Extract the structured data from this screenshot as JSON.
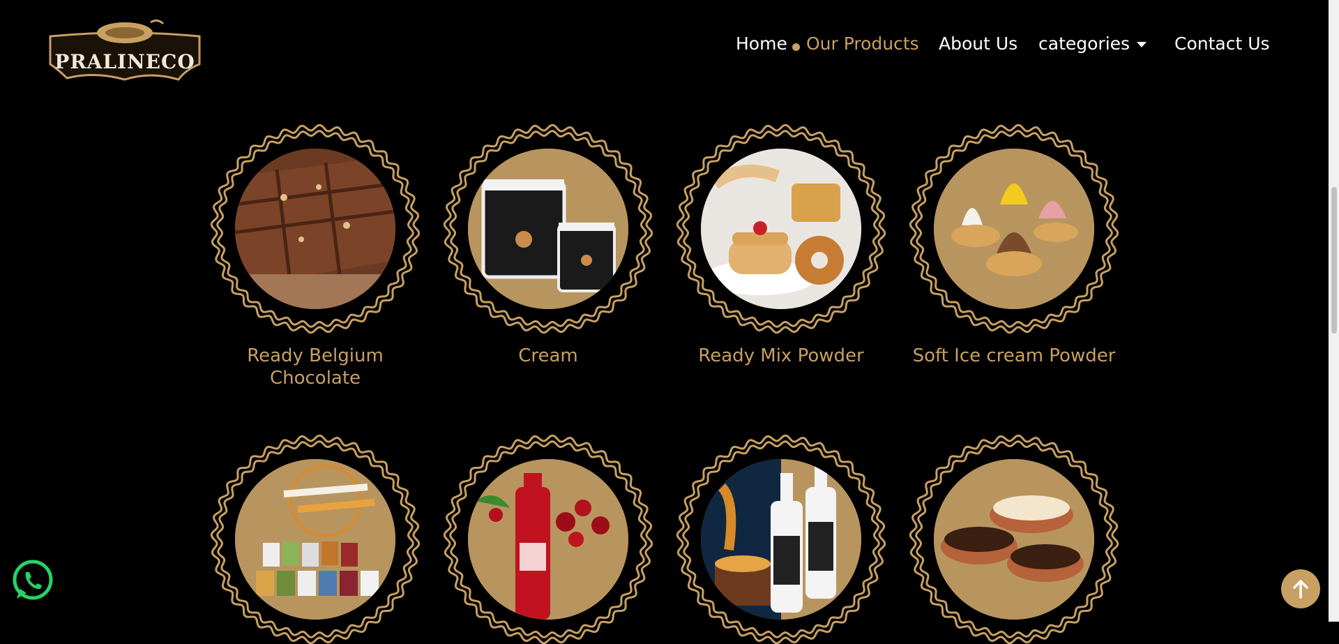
{
  "brand": {
    "name": "PRALINECO"
  },
  "nav": {
    "items": [
      {
        "label": "Home"
      },
      {
        "label": "Our Products"
      },
      {
        "label": "About Us"
      },
      {
        "label": "categories"
      },
      {
        "label": "Contact Us"
      }
    ],
    "active_index": 1
  },
  "products": [
    {
      "label": "Ready Belgium\nChocolate",
      "image": "chocolate-bar-image"
    },
    {
      "label": "Cream",
      "image": "cream-tubs-image"
    },
    {
      "label": "Ready Mix Powder",
      "image": "pancakes-waffles-image"
    },
    {
      "label": "Soft Ice cream Powder",
      "image": "soft-serve-ice-cream-image"
    },
    {
      "label": "",
      "image": "wafer-truffles-cans-image"
    },
    {
      "label": "",
      "image": "cherry-syrup-bottle-image"
    },
    {
      "label": "",
      "image": "sauce-bottles-image"
    },
    {
      "label": "",
      "image": "chocolate-chips-bowls-image"
    }
  ],
  "colors": {
    "background": "#000000",
    "accent": "#c7a062",
    "text": "#ffffff"
  },
  "icons": {
    "whatsapp": "whatsapp-icon",
    "back_to_top": "arrow-up-icon"
  }
}
